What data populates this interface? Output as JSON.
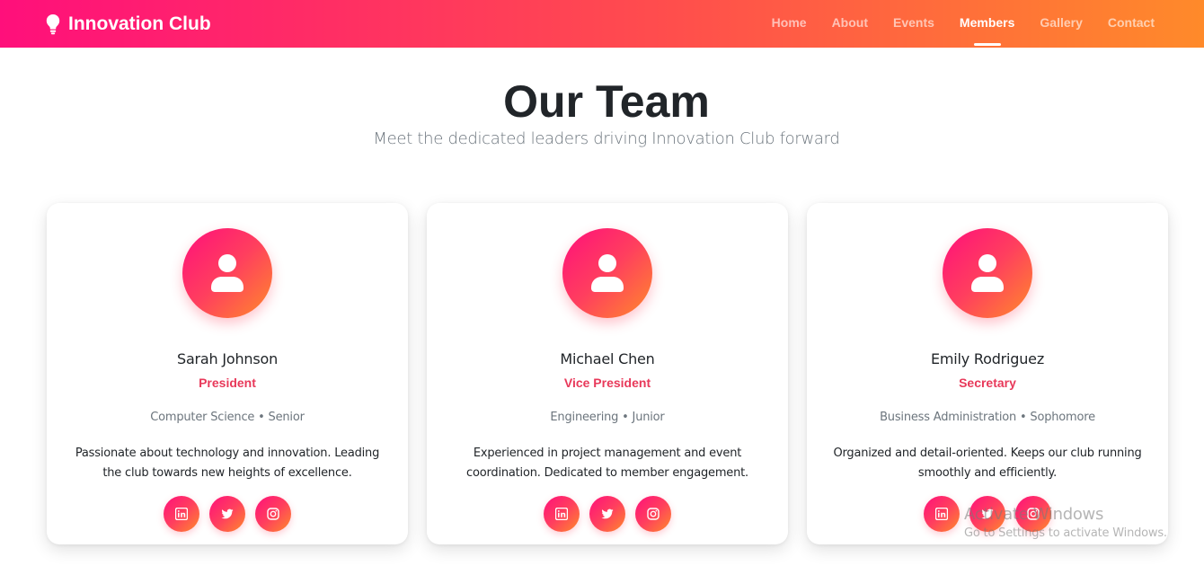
{
  "brand": {
    "name": "Innovation Club",
    "icon": "lightbulb-icon"
  },
  "nav": {
    "items": [
      {
        "label": "Home",
        "active": false
      },
      {
        "label": "About",
        "active": false
      },
      {
        "label": "Events",
        "active": false
      },
      {
        "label": "Members",
        "active": true
      },
      {
        "label": "Gallery",
        "active": false
      },
      {
        "label": "Contact",
        "active": false
      }
    ]
  },
  "header": {
    "title": "Our Team",
    "subtitle": "Meet the dedicated leaders driving Innovation Club forward"
  },
  "members": [
    {
      "name": "Sarah Johnson",
      "role": "President",
      "department": "Computer Science • Senior",
      "bio": "Passionate about technology and innovation. Leading the club towards new heights of excellence.",
      "socials": [
        "linkedin-icon",
        "twitter-icon",
        "instagram-icon"
      ]
    },
    {
      "name": "Michael Chen",
      "role": "Vice President",
      "department": "Engineering • Junior",
      "bio": "Experienced in project management and event coordination. Dedicated to member engagement.",
      "socials": [
        "linkedin-icon",
        "twitter-icon",
        "instagram-icon"
      ]
    },
    {
      "name": "Emily Rodriguez",
      "role": "Secretary",
      "department": "Business Administration • Sophomore",
      "bio": "Organized and detail-oriented. Keeps our club running smoothly and efficiently.",
      "socials": [
        "linkedin-icon",
        "twitter-icon",
        "instagram-icon"
      ]
    }
  ],
  "watermark": {
    "title": "Activate Windows",
    "subtitle": "Go to Settings to activate Windows."
  },
  "colors": {
    "gradient_start": "#ff0f7b",
    "gradient_end": "#ff8a2a",
    "role_accent": "#e8395a",
    "heading": "#212529",
    "muted": "#6c757d"
  }
}
